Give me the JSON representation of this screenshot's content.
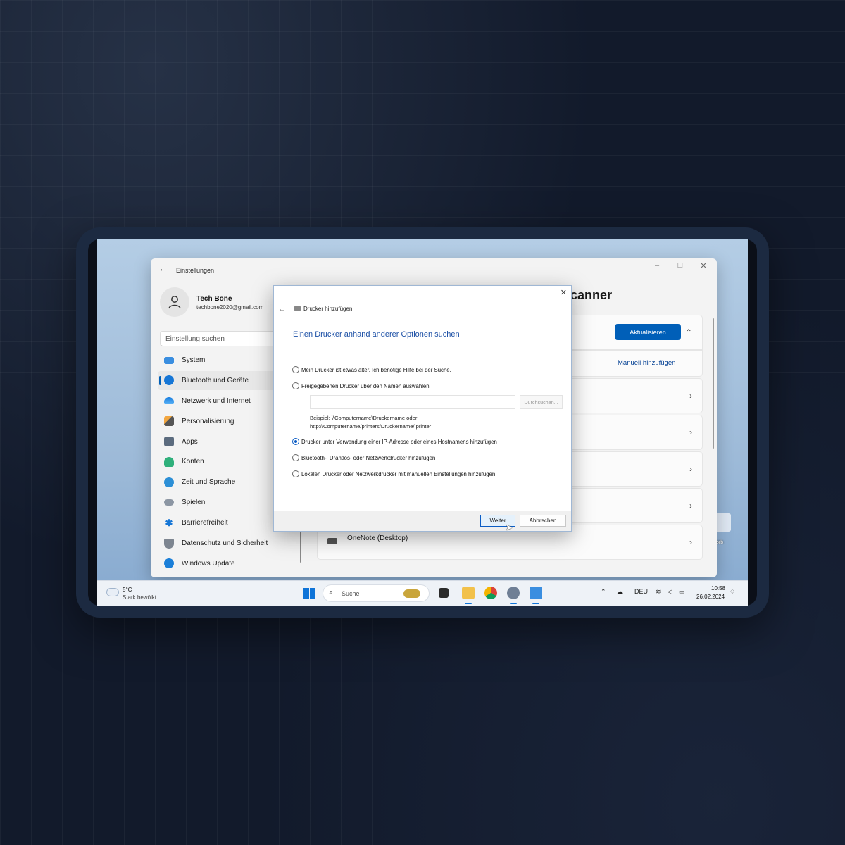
{
  "settings": {
    "title": "Einstellungen",
    "profile": {
      "name": "Tech Bone",
      "email": "techbone2020@gmail.com"
    },
    "search_placeholder": "Einstellung suchen",
    "nav": [
      {
        "label": "System",
        "icon": "monitor-icon",
        "active": false
      },
      {
        "label": "Bluetooth und Geräte",
        "icon": "bluetooth-icon",
        "active": true
      },
      {
        "label": "Netzwerk und Internet",
        "icon": "wifi-icon",
        "active": false
      },
      {
        "label": "Personalisierung",
        "icon": "brush-icon",
        "active": false
      },
      {
        "label": "Apps",
        "icon": "apps-icon",
        "active": false
      },
      {
        "label": "Konten",
        "icon": "account-icon",
        "active": false
      },
      {
        "label": "Zeit und Sprache",
        "icon": "globe-clock-icon",
        "active": false
      },
      {
        "label": "Spielen",
        "icon": "gamepad-icon",
        "active": false
      },
      {
        "label": "Barrierefreiheit",
        "icon": "accessibility-icon",
        "active": false
      },
      {
        "label": "Datenschutz und Sicherheit",
        "icon": "shield-icon",
        "active": false
      },
      {
        "label": "Windows Update",
        "icon": "update-icon",
        "active": false
      }
    ],
    "page_title_fragment": "canner",
    "update_button": "Aktualisieren",
    "add_manual_link": "Manuell hinzufügen",
    "last_device": "OneNote (Desktop)",
    "accent_color": "#005fb8"
  },
  "dialog": {
    "title": "Drucker hinzufügen",
    "heading": "Einen Drucker anhand anderer Optionen suchen",
    "options": [
      {
        "label": "Mein Drucker ist etwas älter. Ich benötige Hilfe bei der Suche.",
        "checked": false
      },
      {
        "label": "Freigegebenen Drucker über den Namen auswählen",
        "checked": false
      },
      {
        "label": "Drucker unter Verwendung einer IP-Adresse oder eines Hostnamens hinzufügen",
        "checked": true
      },
      {
        "label": "Bluetooth-, Drahtlos- oder Netzwerkdrucker hinzufügen",
        "checked": false
      },
      {
        "label": "Lokalen Drucker oder Netzwerkdrucker mit manuellen Einstellungen hinzufügen",
        "checked": false
      }
    ],
    "name_input_value": "",
    "browse_button": "Durchsuchen...",
    "example_line1": "Beispiel: \\\\Computername\\Druckername oder",
    "example_line2": "http://Computername/printers/Druckername/.printer",
    "next_button": "Weiter",
    "cancel_button": "Abbrechen"
  },
  "taskbar": {
    "weather_temp": "5°C",
    "weather_desc": "Stark bewölkt",
    "search_placeholder": "Suche",
    "language": "DEU",
    "time": "10:58",
    "date": "26.02.2024"
  }
}
